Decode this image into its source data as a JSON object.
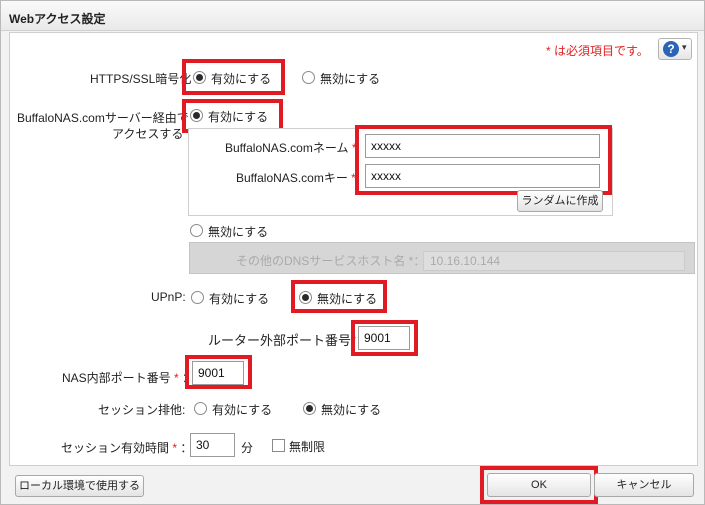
{
  "dialog": {
    "title": "Webアクセス設定"
  },
  "required_note": "* は必須項目です。",
  "help": {
    "label": "?",
    "caret": "▾"
  },
  "https": {
    "label": "HTTPS/SSL暗号化",
    "enable": "有効にする",
    "disable": "無効にする",
    "selected": "enable"
  },
  "buffalonas": {
    "label_line1": "BuffaloNAS.comサーバー経由で",
    "label_line2": "アクセスする",
    "enable": "有効にする",
    "disable": "無効にする",
    "name_label": "BuffaloNAS.comネーム",
    "name_value": "xxxxx",
    "key_label": "BuffaloNAS.comキー",
    "key_value": "xxxxx",
    "random_button": "ランダムに作成",
    "other_dns_label": "その他のDNSサービスホスト名 *：",
    "other_dns_value": "10.16.10.144"
  },
  "upnp": {
    "label": "UPnP:",
    "enable": "有効にする",
    "disable": "無効にする",
    "selected": "disable"
  },
  "router_port": {
    "label": "ルーター外部ポート番号",
    "value": "9001"
  },
  "nas_port": {
    "label": "NAS内部ポート番号",
    "value": "9001"
  },
  "session_exclusive": {
    "label": "セッション排他:",
    "enable": "有効にする",
    "disable": "無効にする",
    "selected": "disable"
  },
  "session_timeout": {
    "label": "セッション有効時間",
    "value": "30",
    "unit": "分",
    "unlimited": "無制限"
  },
  "required_mark": "*",
  "colon": "：",
  "footer": {
    "local_button": "ローカル環境で使用する",
    "ok": "OK",
    "cancel": "キャンセル"
  }
}
